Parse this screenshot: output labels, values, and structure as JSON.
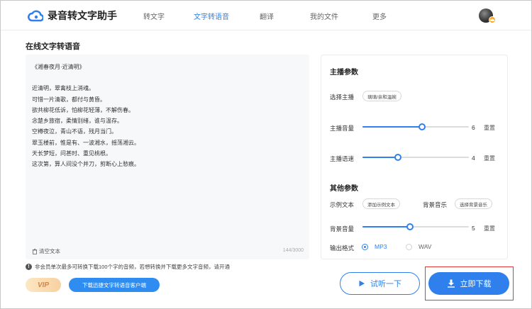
{
  "app": {
    "name": "录音转文字助手"
  },
  "nav": [
    {
      "label": "转文字",
      "active": false
    },
    {
      "label": "文字转语音",
      "active": true
    },
    {
      "label": "翻译",
      "active": false
    },
    {
      "label": "我的文件",
      "active": false
    },
    {
      "label": "更多",
      "active": false
    }
  ],
  "page": {
    "title": "在线文字转语音"
  },
  "editor": {
    "title": "《湘春夜月·近清明》",
    "lines": [
      "近清明，翠禽枝上消魂。",
      "可惜一片清歌，都付与黄昏。",
      "欲共柳花低诉，怕柳花轻薄，不解伤春。",
      "念楚乡旅宿，柔情别绪，谁与温存。",
      "空樽夜泣，青山不语，残月当门。",
      "翠玉楼前，惟是有、一波湘水，摇荡湘云。",
      "天长梦短，问甚时、重见桃根。",
      "这次第，算人间没个并刀，剪断心上愁痕。"
    ],
    "clear_label": "清空文本",
    "char_count": "144/3000"
  },
  "notice": "非会员单次最多可转换下载100个字的音频，若想转换并下载更多文字音频，请开通",
  "vip_label": "VIP",
  "client_button": "下载迅捷文字转语音客户端",
  "settings": {
    "anchor_section": "主播参数",
    "anchor_label": "选择主播",
    "anchor_value": "璃璃/亲和温婉",
    "volume_label": "主播音量",
    "volume_value": "6",
    "speed_label": "主播语速",
    "speed_value": "4",
    "reset_label": "重置",
    "other_section": "其他参数",
    "sample_label": "示例文本",
    "sample_button": "添加示例文本",
    "bgm_label": "背景音乐",
    "bgm_button": "选择背景音乐",
    "bg_volume_label": "背景音量",
    "bg_volume_value": "5",
    "format_label": "输出格式",
    "formats": [
      {
        "label": "MP3",
        "checked": true
      },
      {
        "label": "WAV",
        "checked": false
      }
    ]
  },
  "actions": {
    "listen": "试听一下",
    "download": "立即下载"
  },
  "colors": {
    "accent": "#2f80ed",
    "highlight_border": "#e53935"
  }
}
